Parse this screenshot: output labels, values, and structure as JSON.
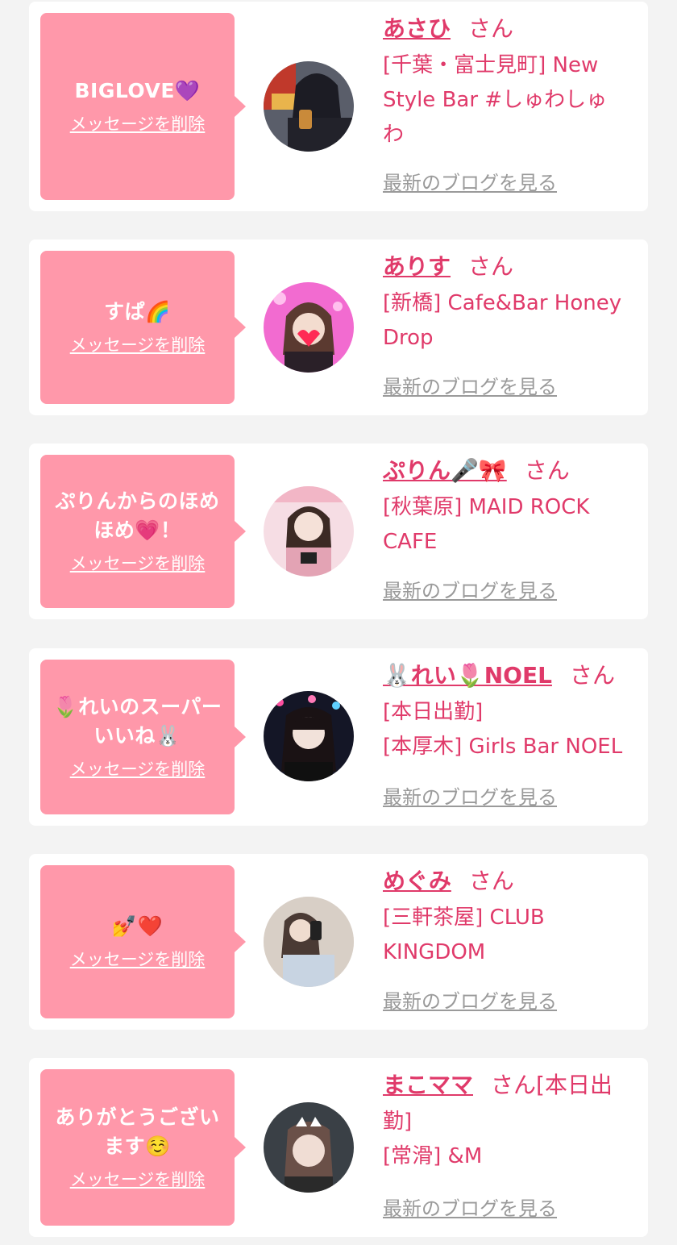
{
  "delete_label": "メッセージを削除",
  "blog_label": "最新のブログを見る",
  "san_label": "さん",
  "colors": {
    "page_bg": "#f3f3f3",
    "card_bg": "#ffffff",
    "bubble": "#ff98aa",
    "name": "#e03a6a",
    "link_gray": "#9a9a9a"
  },
  "cards": [
    {
      "message": "BIGLOVE💜",
      "name": "あさひ",
      "shop_lines": [
        "[千葉・富士見町] New",
        "Style Bar #しゅわしゅ",
        "わ"
      ]
    },
    {
      "message": "すぱ🌈",
      "name": "ありす",
      "shop_lines": [
        "[新橋] Cafe&Bar Honey",
        "Drop"
      ]
    },
    {
      "message": "ぷりんからのほめほめ💗！",
      "name": "ぷりん🎤🎀",
      "shop_lines": [
        "[秋葉原] MAID ROCK",
        "CAFE"
      ]
    },
    {
      "message": "🌷れいのスーパーいいね🐰",
      "name": "🐰れい🌷NOEL",
      "shop_lines": [
        "[本日出勤]",
        "[本厚木] Girls Bar NOEL"
      ]
    },
    {
      "message": "💅❤️",
      "name": "めぐみ",
      "shop_lines": [
        "[三軒茶屋] CLUB",
        "KINGDOM"
      ]
    },
    {
      "message": "ありがとうございます☺️",
      "name": "まこママ",
      "name_suffix": "[本日出",
      "shop_lines": [
        "勤]",
        "[常滑] &M"
      ]
    }
  ]
}
